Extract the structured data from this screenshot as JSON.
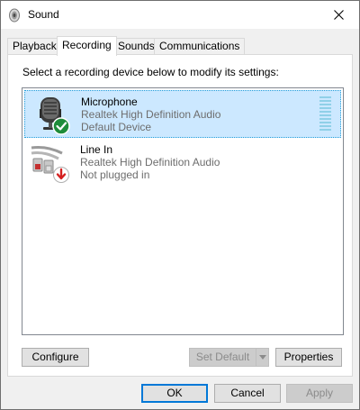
{
  "window": {
    "title": "Sound"
  },
  "tabs": [
    {
      "label": "Playback",
      "active": false
    },
    {
      "label": "Recording",
      "active": true
    },
    {
      "label": "Sounds",
      "active": false
    },
    {
      "label": "Communications",
      "active": false
    }
  ],
  "panel": {
    "instruction": "Select a recording device below to modify its settings:"
  },
  "devices": [
    {
      "name": "Microphone",
      "description": "Realtek High Definition Audio",
      "status": "Default Device",
      "icon": "microphone-icon",
      "badge": "green-check-badge",
      "selected": true
    },
    {
      "name": "Line In",
      "description": "Realtek High Definition Audio",
      "status": "Not plugged in",
      "icon": "line-in-cable-icon",
      "badge": "red-down-arrow-badge",
      "selected": false
    }
  ],
  "panel_buttons": {
    "configure": "Configure",
    "set_default": "Set Default",
    "properties": "Properties"
  },
  "dialog_buttons": {
    "ok": "OK",
    "cancel": "Cancel",
    "apply": "Apply"
  },
  "colors": {
    "selection_bg": "#cce8ff",
    "selection_border": "#26a0da",
    "accent": "#0078d7",
    "check_green": "#1e8c3a",
    "unplugged_red": "#d42020"
  }
}
